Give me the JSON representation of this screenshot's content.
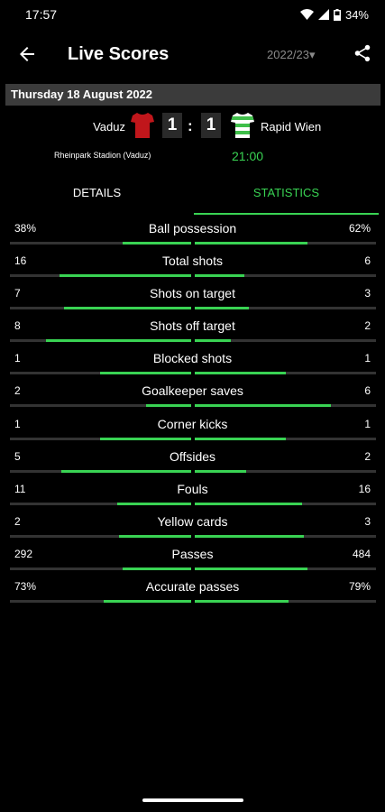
{
  "status": {
    "time": "17:57",
    "battery": "34%"
  },
  "appbar": {
    "title": "Live Scores",
    "season": "2022/23"
  },
  "date": "Thursday 18 August 2022",
  "match": {
    "home": "Vaduz",
    "away": "Rapid Wien",
    "home_score": "1",
    "away_score": "1",
    "separator": ":",
    "stadium": "Rheinpark Stadion (Vaduz)",
    "kickoff": "21:00"
  },
  "tabs": {
    "details": "DETAILS",
    "statistics": "STATISTICS"
  },
  "colors": {
    "accent": "#39d353",
    "home_jersey": "#c0161b",
    "away_jersey": "#3fbf4a"
  },
  "stats": [
    {
      "label": "Ball possession",
      "home": "38%",
      "away": "62%",
      "home_val": 38,
      "away_val": 62
    },
    {
      "label": "Total shots",
      "home": "16",
      "away": "6",
      "home_val": 16,
      "away_val": 6
    },
    {
      "label": "Shots on target",
      "home": "7",
      "away": "3",
      "home_val": 7,
      "away_val": 3
    },
    {
      "label": "Shots off target",
      "home": "8",
      "away": "2",
      "home_val": 8,
      "away_val": 2
    },
    {
      "label": "Blocked shots",
      "home": "1",
      "away": "1",
      "home_val": 1,
      "away_val": 1
    },
    {
      "label": "Goalkeeper saves",
      "home": "2",
      "away": "6",
      "home_val": 2,
      "away_val": 6
    },
    {
      "label": "Corner kicks",
      "home": "1",
      "away": "1",
      "home_val": 1,
      "away_val": 1
    },
    {
      "label": "Offsides",
      "home": "5",
      "away": "2",
      "home_val": 5,
      "away_val": 2
    },
    {
      "label": "Fouls",
      "home": "11",
      "away": "16",
      "home_val": 11,
      "away_val": 16
    },
    {
      "label": "Yellow cards",
      "home": "2",
      "away": "3",
      "home_val": 2,
      "away_val": 3
    },
    {
      "label": "Passes",
      "home": "292",
      "away": "484",
      "home_val": 292,
      "away_val": 484
    },
    {
      "label": "Accurate passes",
      "home": "73%",
      "away": "79%",
      "home_val": 73,
      "away_val": 79
    }
  ]
}
